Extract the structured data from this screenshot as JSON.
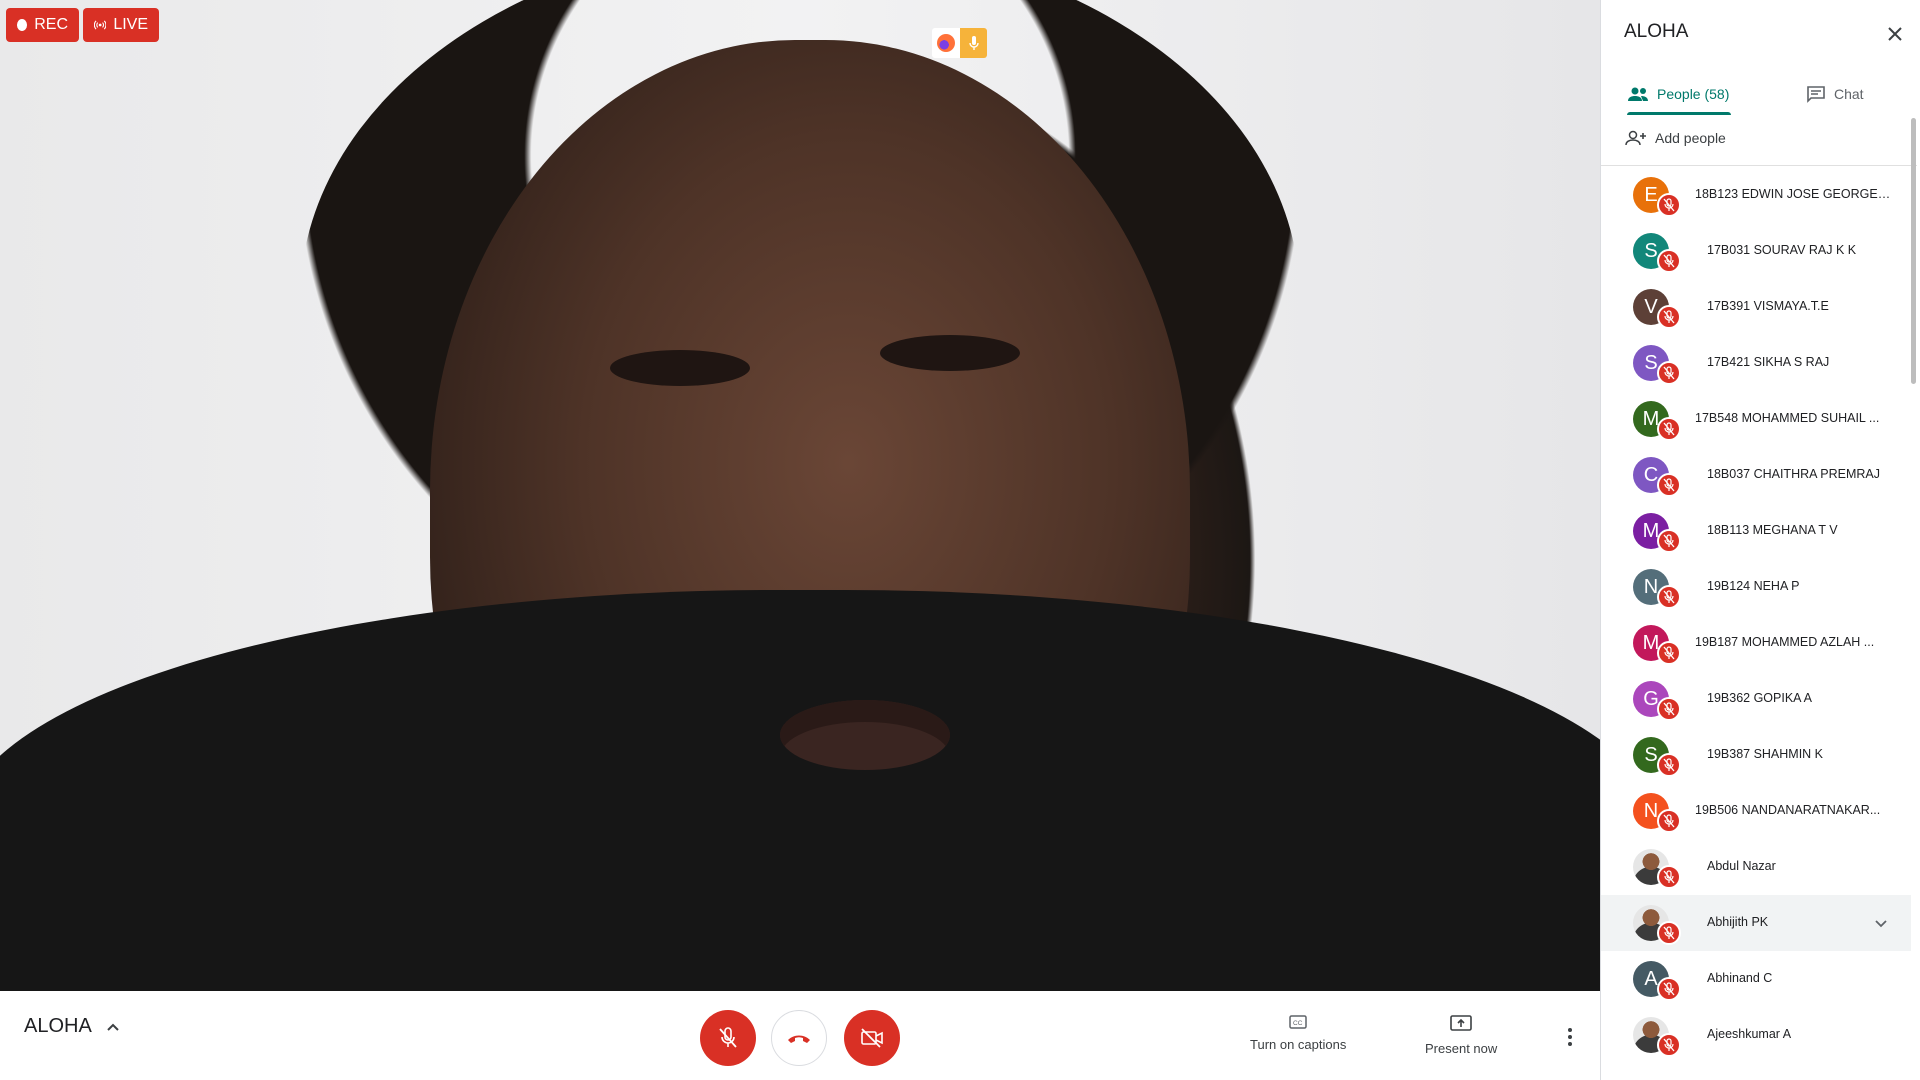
{
  "recording": {
    "rec_label": "REC",
    "live_label": "LIVE",
    "accent": "#d93025"
  },
  "meeting": {
    "name": "ALOHA"
  },
  "controls": {
    "mic": {
      "state": "muted",
      "icon": "mic-off-icon"
    },
    "hangup": {
      "icon": "phone-hangup-icon"
    },
    "camera": {
      "state": "off",
      "icon": "videocam-off-icon"
    },
    "captions_label": "Turn on captions",
    "present_label": "Present now"
  },
  "panel": {
    "title": "ALOHA",
    "tabs": [
      {
        "label": "People (58)",
        "active": true,
        "icon": "people-icon"
      },
      {
        "label": "Chat",
        "active": false,
        "icon": "chat-icon"
      }
    ],
    "add_people_label": "Add people",
    "participants": [
      {
        "initial": "E",
        "color": "#e8710a",
        "name": "18B123 EDWIN JOSE GEORGE ..."
      },
      {
        "initial": "S",
        "color": "#12877a",
        "name": "17B031 SOURAV RAJ K K"
      },
      {
        "initial": "V",
        "color": "#5d4037",
        "name": "17B391 VISMAYA.T.E"
      },
      {
        "initial": "S",
        "color": "#7e57c2",
        "name": "17B421 SIKHA S RAJ"
      },
      {
        "initial": "M",
        "color": "#33691e",
        "name": "17B548 MOHAMMED SUHAIL ..."
      },
      {
        "initial": "C",
        "color": "#7e57c2",
        "name": "18B037 CHAITHRA PREMRAJ"
      },
      {
        "initial": "M",
        "color": "#7b1fa2",
        "name": "18B113 MEGHANA T V"
      },
      {
        "initial": "N",
        "color": "#546e7a",
        "name": "19B124 NEHA P"
      },
      {
        "initial": "M",
        "color": "#c2185b",
        "name": "19B187 MOHAMMED AZLAH ..."
      },
      {
        "initial": "G",
        "color": "#ab47bc",
        "name": "19B362 GOPIKA A"
      },
      {
        "initial": "S",
        "color": "#33691e",
        "name": "19B387 SHAHMIN K"
      },
      {
        "initial": "N",
        "color": "#f4511e",
        "name": "19B506 NANDANARATNAKAR..."
      },
      {
        "initial": "",
        "color": "photo",
        "name": "Abdul Nazar"
      },
      {
        "initial": "",
        "color": "photo",
        "name": "Abhijith PK"
      },
      {
        "initial": "A",
        "color": "#455a64",
        "name": "Abhinand C"
      },
      {
        "initial": "",
        "color": "photo",
        "name": "Ajeeshkumar A"
      }
    ]
  }
}
